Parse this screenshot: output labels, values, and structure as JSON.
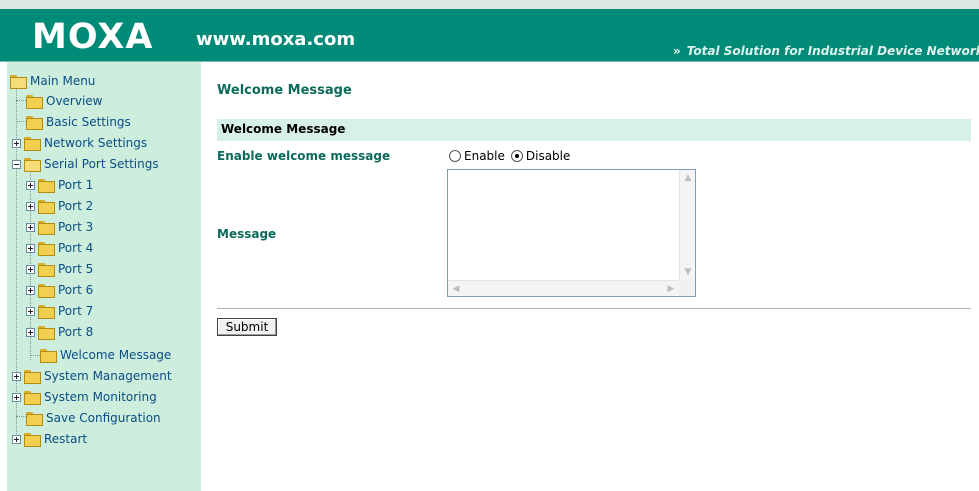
{
  "header": {
    "logo": "MOXA",
    "site": "www.moxa.com",
    "tagline_chevrons": "»",
    "tagline": "Total Solution for Industrial Device Networking"
  },
  "sidebar": {
    "root": "Main Menu",
    "items": [
      {
        "label": "Overview"
      },
      {
        "label": "Basic Settings"
      },
      {
        "label": "Network Settings"
      },
      {
        "label": "Serial Port Settings"
      },
      {
        "label": "Port 1"
      },
      {
        "label": "Port 2"
      },
      {
        "label": "Port 3"
      },
      {
        "label": "Port 4"
      },
      {
        "label": "Port 5"
      },
      {
        "label": "Port 6"
      },
      {
        "label": "Port 7"
      },
      {
        "label": "Port 8"
      },
      {
        "label": "Welcome Message"
      },
      {
        "label": "System Management"
      },
      {
        "label": "System Monitoring"
      },
      {
        "label": "Save Configuration"
      },
      {
        "label": "Restart"
      }
    ]
  },
  "main": {
    "page_title": "Welcome Message",
    "section_header": "Welcome Message",
    "enable_label": "Enable welcome message",
    "radio_enable": "Enable",
    "radio_disable": "Disable",
    "selected_option": "Disable",
    "message_label": "Message",
    "message_value": "",
    "submit_label": "Submit"
  },
  "colors": {
    "header_bg": "#008a78",
    "sidebar_bg": "#cdeedd",
    "accent_text": "#0b6a5a",
    "menu_text": "#0a4d86"
  }
}
